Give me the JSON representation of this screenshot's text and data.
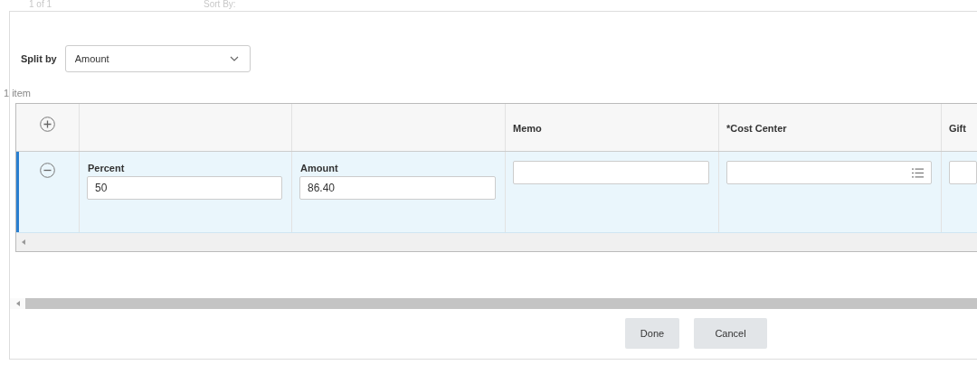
{
  "top_bar": {
    "page_count": "1 of 1",
    "sort_label": "Sort By:"
  },
  "split_by": {
    "label": "Split by",
    "value": "Amount"
  },
  "item_count": "1 item",
  "table": {
    "columns": [
      null,
      null,
      "Memo",
      "*Cost Center",
      "Gift"
    ],
    "rows": [
      {
        "selected": true,
        "cells": [
          {
            "kind": "text",
            "label": "Percent",
            "value": "50"
          },
          {
            "kind": "text",
            "label": "Amount",
            "value": "86.40"
          },
          {
            "kind": "text"
          },
          {
            "kind": "prompt"
          },
          {
            "kind": "text"
          }
        ]
      }
    ]
  },
  "buttons": [
    "Done",
    "Cancel"
  ]
}
